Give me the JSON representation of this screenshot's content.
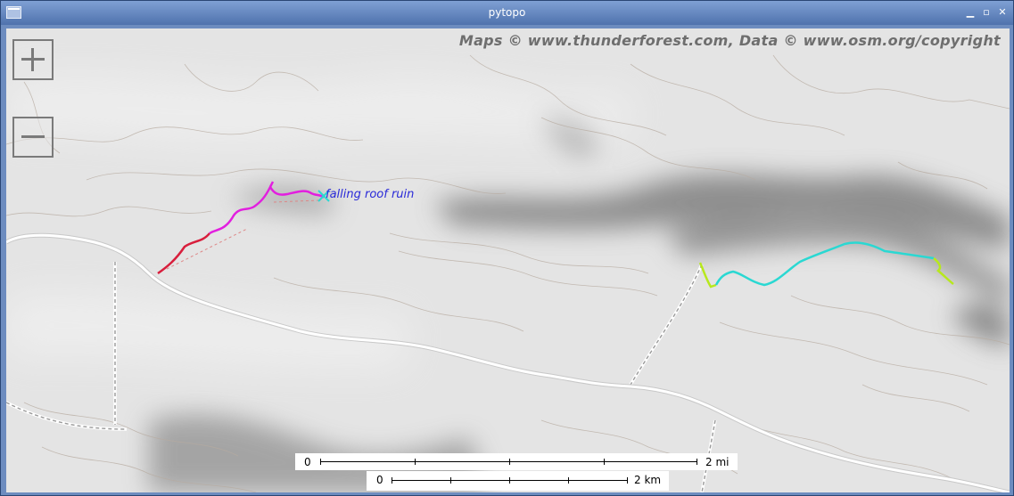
{
  "window": {
    "title": "pytopo"
  },
  "map": {
    "attribution": "Maps © www.thunderforest.com, Data © www.osm.org/copyright",
    "waypoint": {
      "label": "falling roof ruin"
    },
    "track_colors": [
      "#d81e3c",
      "#e21fdf",
      "#2ad8d2",
      "#b7e81d"
    ],
    "road_color": "#ffffff",
    "scale_mi": {
      "start": "0",
      "end": "2 mi"
    },
    "scale_km": {
      "start": "0",
      "end": "2 km"
    }
  },
  "controls": {
    "zoom_in": "zoom-in",
    "zoom_out": "zoom-out"
  }
}
